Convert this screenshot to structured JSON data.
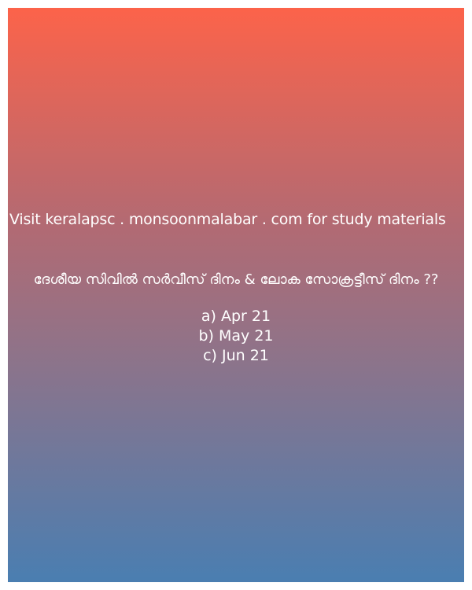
{
  "promo": {
    "text": "Visit keralapsc . monsoonmalabar . com for study materials"
  },
  "question": {
    "text": "ദേശീയ സിവിൽ സർവീസ് ദിനം & ലോക സോക്രട്ടീസ് ദിനം ??"
  },
  "options": [
    "a) Apr 21",
    "b) May 21",
    "c) Jun 21"
  ],
  "colors": {
    "gradient_top": "#fc634a",
    "gradient_bottom": "#4a7eb1",
    "text": "#ffffff"
  }
}
